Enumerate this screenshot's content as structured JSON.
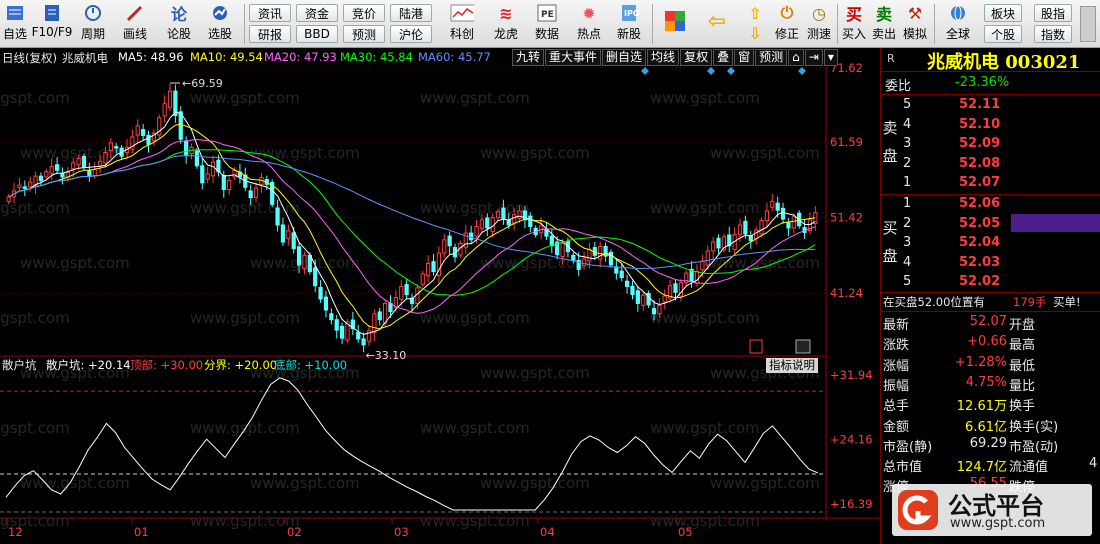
{
  "toolbar": {
    "icon_buttons": [
      {
        "label": "自选",
        "icon": "star-list-icon"
      },
      {
        "label": "F10/F9",
        "icon": "f10-info-icon"
      },
      {
        "label": "周期",
        "icon": "clock-cycle-icon"
      },
      {
        "label": "画线",
        "icon": "pen-draw-icon"
      },
      {
        "label": "论股",
        "icon": "discuss-stock-icon"
      },
      {
        "label": "选股",
        "icon": "stock-picker-icon"
      }
    ],
    "text_buttons_top": [
      "资讯",
      "资金",
      "竞价",
      "陆港"
    ],
    "text_buttons_bottom": [
      "研报",
      "BBD",
      "预测",
      "沪伦"
    ],
    "feature_buttons": [
      {
        "label": "科创",
        "icon": "sci-tech-board-icon"
      },
      {
        "label": "龙虎",
        "icon": "dragon-tiger-icon"
      },
      {
        "label": "数据",
        "icon": "pe-data-icon"
      },
      {
        "label": "热点",
        "icon": "hotspot-icon"
      },
      {
        "label": "新股",
        "icon": "ipo-icon"
      }
    ],
    "right_buttons": [
      {
        "label": "修正",
        "icon": "revise-icon"
      },
      {
        "label": "测速",
        "icon": "speed-test-icon"
      },
      {
        "label": "买入",
        "icon": "buy-icon"
      },
      {
        "label": "卖出",
        "icon": "sell-icon"
      },
      {
        "label": "模拟",
        "icon": "simulate-icon"
      },
      {
        "label": "全球",
        "icon": "globe-icon"
      }
    ],
    "right_text_top": [
      "板块",
      "股指"
    ],
    "right_text_bottom": [
      "个股",
      "指数"
    ],
    "colors": {
      "buy": "#cc0000",
      "sell": "#007a00"
    }
  },
  "chart_header": {
    "period_label": "日线(复权)",
    "stock_name": "兆威机电",
    "ma5": "MA5: 48.96",
    "ma10": "MA10: 49.54",
    "ma20": "MA20: 47.93",
    "ma30": "MA30: 45.84",
    "ma60": "MA60: 45.77",
    "buttons": [
      "九转",
      "重大事件",
      "删自选",
      "均线",
      "复权",
      "叠",
      "窗",
      "预测"
    ]
  },
  "indicator_header": {
    "name": "散户坑",
    "value": "散户坑: +20.14",
    "top": "顶部: +30.00",
    "boundary": "分界: +20.00",
    "bottom": "底部: +10.00",
    "help": "指标说明"
  },
  "chart_data": [
    {
      "type": "candlestick",
      "title": "兆威机电 日线(复权)",
      "ylim": [
        33.1,
        71.62
      ],
      "y_ticks": [
        "71.62",
        "61.59",
        "51.42",
        "41.24"
      ],
      "high_annotation": "69.59",
      "low_annotation": "33.10",
      "x_ticks": [
        "12",
        "01",
        "02",
        "03",
        "04",
        "05"
      ],
      "series_colors": {
        "MA5": "#ffffff",
        "MA10": "#ffff00",
        "MA20": "#ff66ff",
        "MA30": "#00ff00",
        "MA60": "#6090ff"
      },
      "closes": [
        54.2,
        55.0,
        55.8,
        55.3,
        56.2,
        57.0,
        56.4,
        57.6,
        58.3,
        57.8,
        56.9,
        57.5,
        58.8,
        59.4,
        58.2,
        57.1,
        57.9,
        59.0,
        60.2,
        61.5,
        60.8,
        59.7,
        60.9,
        62.3,
        63.8,
        62.5,
        61.3,
        62.8,
        64.9,
        66.8,
        68.5,
        65.2,
        62.0,
        59.8,
        60.9,
        58.4,
        56.1,
        57.3,
        58.9,
        57.6,
        55.2,
        56.4,
        57.8,
        56.9,
        55.5,
        54.1,
        55.4,
        56.8,
        55.9,
        53.2,
        50.4,
        48.1,
        49.6,
        47.2,
        45.0,
        46.3,
        44.1,
        42.2,
        40.4,
        38.9,
        37.6,
        36.2,
        35.1,
        37.3,
        36.4,
        35.0,
        34.2,
        36.1,
        38.4,
        37.6,
        39.8,
        38.7,
        40.6,
        42.1,
        41.0,
        39.8,
        41.9,
        43.8,
        45.2,
        44.1,
        46.6,
        48.4,
        47.6,
        46.1,
        47.9,
        49.3,
        48.4,
        50.2,
        51.1,
        50.0,
        51.4,
        52.2,
        51.3,
        50.4,
        51.8,
        52.3,
        51.1,
        50.2,
        49.1,
        50.3,
        48.9,
        47.6,
        46.4,
        47.9,
        46.8,
        45.6,
        44.4,
        45.8,
        47.1,
        46.3,
        47.5,
        46.2,
        45.0,
        43.9,
        43.3,
        42.1,
        41.0,
        39.8,
        40.9,
        39.6,
        38.4,
        39.5,
        40.8,
        42.2,
        41.3,
        42.6,
        43.9,
        42.8,
        44.1,
        45.5,
        46.9,
        48.1,
        47.3,
        48.8,
        47.6,
        49.1,
        50.4,
        49.2,
        48.3,
        49.7,
        51.0,
        52.3,
        53.6,
        52.4,
        51.2,
        50.0,
        51.5,
        50.3,
        49.4,
        51.1,
        52.07
      ],
      "ma_note": "MA5/MA10/MA20/MA30/MA60 computed from closes"
    },
    {
      "type": "line",
      "title": "散户坑",
      "ylim": [
        16.39,
        31.94
      ],
      "y_ticks": [
        "+31.94",
        "+24.16",
        "+16.39"
      ],
      "reference_lines": {
        "top": 30.0,
        "boundary": 20.0,
        "bottom": 10.0
      },
      "values": [
        17.2,
        18.6,
        19.8,
        20.4,
        19.3,
        18.1,
        17.6,
        18.9,
        20.8,
        22.9,
        24.4,
        26.1,
        25.0,
        23.2,
        21.9,
        20.6,
        19.4,
        18.7,
        18.1,
        19.6,
        21.3,
        22.8,
        24.2,
        23.1,
        22.0,
        23.6,
        25.1,
        26.8,
        28.9,
        30.8,
        31.6,
        31.2,
        30.1,
        28.4,
        26.9,
        25.3,
        24.1,
        23.0,
        22.2,
        21.5,
        20.9,
        20.3,
        19.6,
        19.0,
        18.4,
        17.9,
        17.3,
        16.8,
        16.2,
        15.6,
        15.1,
        14.7,
        14.4,
        14.2,
        14.1,
        14.0,
        14.3,
        14.8,
        15.6,
        16.9,
        18.4,
        20.3,
        22.4,
        23.9,
        24.6,
        24.1,
        23.2,
        22.6,
        23.4,
        24.5,
        23.7,
        22.3,
        21.1,
        20.2,
        21.5,
        22.8,
        21.9,
        23.6,
        24.8,
        24.0,
        22.7,
        21.4,
        23.1,
        24.9,
        25.8,
        24.5,
        23.2,
        21.8,
        20.6,
        20.14
      ]
    }
  ],
  "right_panel": {
    "title": "兆威机电 003021",
    "r_label": "R",
    "weibi_label": "委比",
    "weibi_value": "-23.36%",
    "sell_label": "卖\n盘",
    "buy_label": "买\n盘",
    "sell_levels": [
      {
        "level": "5",
        "price": "52.11"
      },
      {
        "level": "4",
        "price": "52.10"
      },
      {
        "level": "3",
        "price": "52.09"
      },
      {
        "level": "2",
        "price": "52.08"
      },
      {
        "level": "1",
        "price": "52.07"
      }
    ],
    "buy_levels": [
      {
        "level": "1",
        "price": "52.06"
      },
      {
        "level": "2",
        "price": "52.05"
      },
      {
        "level": "3",
        "price": "52.04"
      },
      {
        "level": "4",
        "price": "52.03"
      },
      {
        "level": "5",
        "price": "52.02"
      }
    ],
    "status_line": {
      "text": "在买盘52.00位置有",
      "qty": "179手",
      "action": "买单!"
    },
    "stats": [
      {
        "l1": "最新",
        "v1": "52.07",
        "c1": "red",
        "l2": "开盘",
        "v2": ""
      },
      {
        "l1": "涨跌",
        "v1": "+0.66",
        "c1": "red",
        "l2": "最高",
        "v2": ""
      },
      {
        "l1": "涨幅",
        "v1": "+1.28%",
        "c1": "red",
        "l2": "最低",
        "v2": ""
      },
      {
        "l1": "振幅",
        "v1": "4.75%",
        "c1": "red",
        "l2": "量比",
        "v2": ""
      },
      {
        "l1": "总手",
        "v1": "12.61万",
        "c1": "yellow",
        "l2": "换手",
        "v2": ""
      },
      {
        "l1": "金额",
        "v1": "6.61亿",
        "c1": "yellow",
        "l2": "换手(实)",
        "v2": ""
      },
      {
        "l1": "市盈(静)",
        "v1": "69.29",
        "c1": "white",
        "l2": "市盈(动)",
        "v2": ""
      },
      {
        "l1": "总市值",
        "v1": "124.7亿",
        "c1": "yellow",
        "l2": "流通值",
        "v2": "4"
      },
      {
        "l1": "涨停",
        "v1": "56.55",
        "c1": "red",
        "l2": "跌停",
        "v2": ""
      }
    ]
  },
  "watermark": {
    "brand": "公式平台",
    "url": "www.gspt.com",
    "chart_wm": "www.gspt.com"
  }
}
